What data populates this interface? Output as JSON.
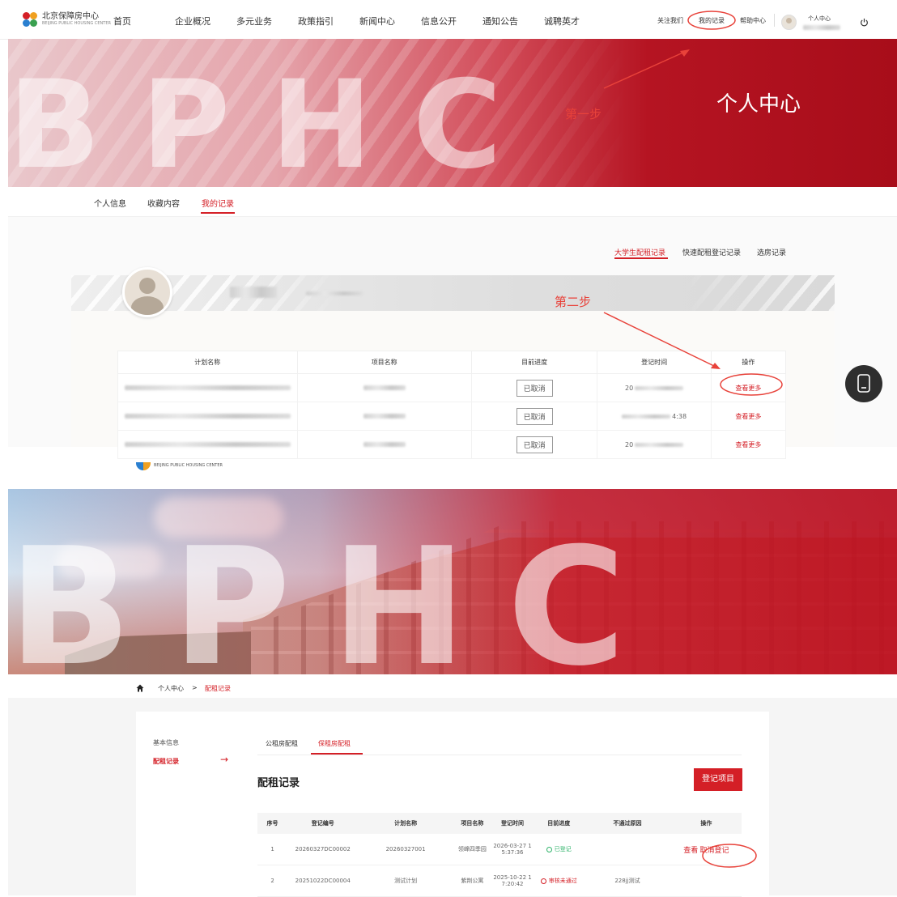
{
  "panel1": {
    "logo": {
      "name": "北京保障房中心",
      "sub": "BEIJING PUBLIC HOUSING CENTER"
    },
    "menu": [
      "首页",
      "企业概况",
      "多元业务",
      "政策指引",
      "新闻中心",
      "信息公开",
      "通知公告",
      "诚聘英才"
    ],
    "right_nav": {
      "follow": "关注我们",
      "my_records": "我的记录",
      "help": "帮助中心",
      "user_center": "个人中心"
    },
    "hero": {
      "letters": "BPHC",
      "title": "个人中心",
      "step": "第一步"
    },
    "tabs": [
      "个人信息",
      "收藏内容",
      "我的记录"
    ],
    "record_tabs": [
      "大学生配租记录",
      "快速配租登记记录",
      "选房记录"
    ],
    "step2": "第二步",
    "table": {
      "headers": [
        "计划名称",
        "项目名称",
        "目前进度",
        "登记时间",
        "操作"
      ],
      "rows": [
        {
          "status": "已取消",
          "time": "20",
          "action": "查看更多"
        },
        {
          "status": "已取消",
          "time": "4:38",
          "action": "查看更多"
        },
        {
          "status": "已取消",
          "time": "20",
          "action": "查看更多"
        }
      ]
    }
  },
  "panel2": {
    "logo_sub": "BEIJING PUBLIC HOUSING CENTER",
    "hero_letters": "BPHC",
    "breadcrumb": {
      "home": "个人中心",
      "sep": ">",
      "current": "配租记录"
    },
    "side_menu": [
      "基本信息",
      "配租记录"
    ],
    "arrow": "→",
    "tabs": [
      "公租房配租",
      "保租房配租"
    ],
    "section_title": "配租记录",
    "register_button": "登记项目",
    "table": {
      "headers": [
        "序号",
        "登记编号",
        "计划名称",
        "项目名称",
        "登记时间",
        "目前进度",
        "不通过原因",
        "操作"
      ],
      "rows": [
        {
          "no": "1",
          "code": "20260327DC00002",
          "plan": "20260327001",
          "project": "领峰四季园",
          "date": "2026-03-27 1",
          "time": "5:37:36",
          "status": "已登记",
          "reason": "",
          "view": "查看",
          "cancel": "取消登记"
        },
        {
          "no": "2",
          "code": "20251022DC00004",
          "plan": "测试计划",
          "project": "紫荆公寓",
          "date": "2025-10-22 1",
          "time": "7:20:42",
          "status": "审核未通过",
          "reason": "228jj测试",
          "view": "",
          "cancel": ""
        }
      ]
    }
  },
  "colors": {
    "brand_red": "#d41f26",
    "green": "#2fb36a",
    "annotation": "#e8423a"
  }
}
